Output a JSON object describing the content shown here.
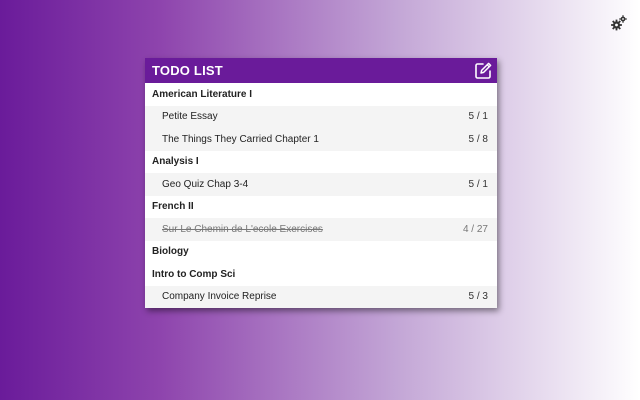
{
  "header": {
    "title": "TODO LIST"
  },
  "icons": {
    "settings": "gears-icon",
    "edit": "edit-pencil-icon"
  },
  "colors": {
    "accent": "#6a1b9a",
    "task_bg": "#f4f4f4"
  },
  "courses": [
    {
      "name": "American Literature I",
      "tasks": [
        {
          "name": "Petite Essay",
          "grade": "5 / 1",
          "done": false
        },
        {
          "name": "The Things They Carried Chapter 1",
          "grade": "5 / 8",
          "done": false
        }
      ]
    },
    {
      "name": "Analysis I",
      "tasks": [
        {
          "name": "Geo Quiz Chap 3-4",
          "grade": "5 / 1",
          "done": false
        }
      ]
    },
    {
      "name": "French II",
      "tasks": [
        {
          "name": "Sur Le Chemin de L'ecole Exercises",
          "grade": "4 / 27",
          "done": true
        }
      ]
    },
    {
      "name": "Biology",
      "tasks": []
    },
    {
      "name": "Intro to Comp Sci",
      "tasks": [
        {
          "name": "Company Invoice Reprise",
          "grade": "5 / 3",
          "done": false
        }
      ]
    }
  ]
}
